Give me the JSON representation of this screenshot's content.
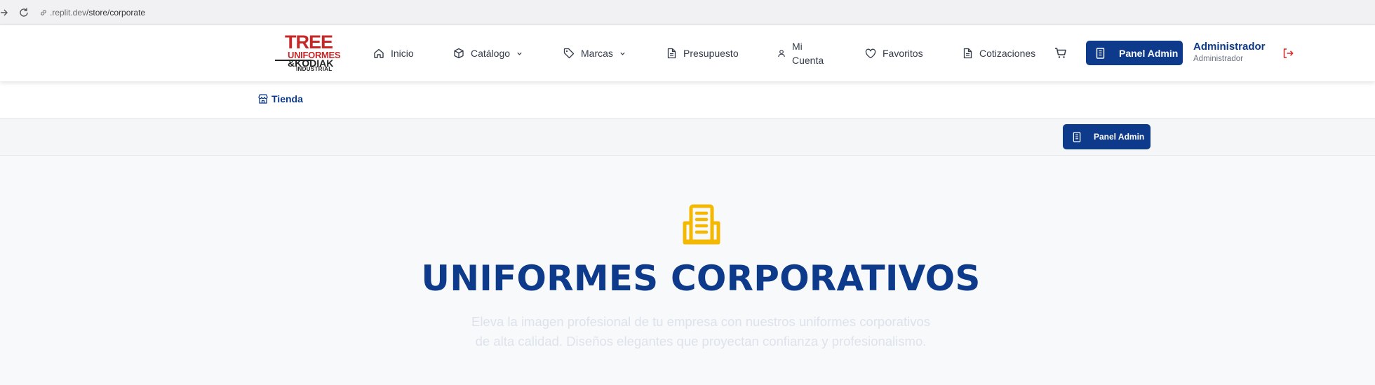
{
  "browser": {
    "url_host": ".replit.dev",
    "url_path": "/store/corporate"
  },
  "logo": {
    "line1": "TREE",
    "line2": "UNIFORMES",
    "line3": "&KODIAK",
    "line4": "INDUSTRIAL"
  },
  "nav": {
    "inicio": "Inicio",
    "catalogo": "Catálogo",
    "marcas": "Marcas",
    "presupuesto": "Presupuesto",
    "mi_cuenta_1": "Mi",
    "mi_cuenta_2": "Cuenta",
    "favoritos": "Favoritos",
    "cotizaciones": "Cotizaciones"
  },
  "header": {
    "panel_admin_label": "Panel Admin",
    "user_name": "Administrador",
    "user_role": "Administrador"
  },
  "breadcrumb": {
    "label": "Tienda"
  },
  "admin_bar": {
    "panel_admin_label": "Panel Admin"
  },
  "hero": {
    "title": "UNIFORMES CORPORATIVOS",
    "description": "Eleva la imagen profesional de tu empresa con nuestros uniformes corporativos de alta calidad. Diseños elegantes que proyectan confianza y profesionalismo."
  },
  "colors": {
    "brand_blue": "#0d3a8a",
    "brand_red": "#c62828",
    "hero_icon": "#f5b800",
    "logout_red": "#e02424"
  },
  "icons": [
    "back-arrow-icon",
    "reload-icon",
    "link-icon",
    "home-icon",
    "box-icon",
    "tag-icon",
    "document-icon",
    "user-icon",
    "heart-icon",
    "cart-icon",
    "building-icon",
    "logout-icon",
    "store-icon"
  ]
}
